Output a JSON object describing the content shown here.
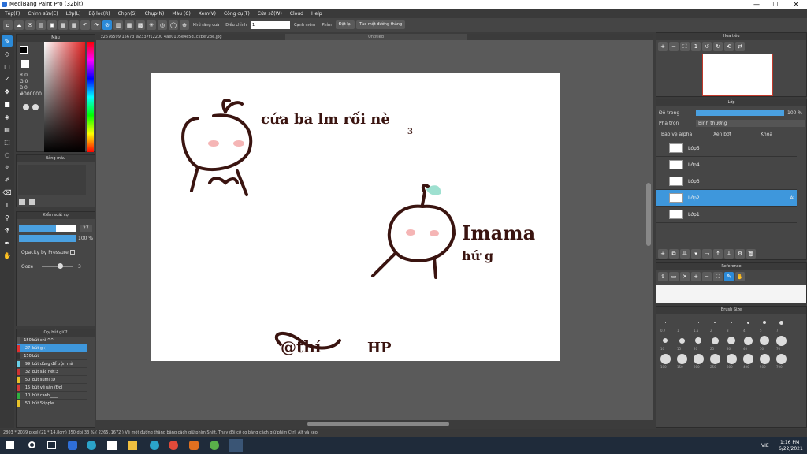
{
  "window": {
    "title": "MediBang Paint Pro (32bit)",
    "min": "—",
    "max": "☐",
    "close": "✕"
  },
  "menu": [
    "Tệp(F)",
    "Chỉnh sửa(E)",
    "Lớp(L)",
    "Bộ lọc(R)",
    "Chọn(S)",
    "Chụp(N)",
    "Màu (C)",
    "Xem(V)",
    "Công cụ(T)",
    "Cửa sổ(W)",
    "Cloud",
    "Help"
  ],
  "toolbar": {
    "anti_alias": "Khử răng cưa",
    "adjust_label": "Điều chỉnh",
    "adjust_value": "1",
    "snap_label": "Cạnh mềm",
    "snap2": "Phím",
    "off_label": "Đặt lại",
    "line_button": "Tạo một đường thẳng"
  },
  "color_panel": {
    "title": "Màu",
    "r": "R 0",
    "g": "G 0",
    "b": "B 0",
    "hex": "#000000"
  },
  "palette_panel": {
    "title": "Bảng màu"
  },
  "brush_control": {
    "title": "Kiểm soát cọ",
    "size_value": "27",
    "opacity_value": "100 %",
    "opacity_by_pressure": "Opacity by Pressure",
    "ooze_label": "Ooze",
    "ooze_value": "3",
    "size_fill": 0.65,
    "opacity_fill": 1.0
  },
  "brush_list": {
    "title": "Cọ/ bút giữ?",
    "items": [
      {
        "size": "150",
        "name": "bút chì ^^",
        "color": "#555555"
      },
      {
        "size": "27",
        "name": "bút g :)",
        "color": "#e03030"
      },
      {
        "size": "150",
        "name": "bút",
        "color": "#333333"
      },
      {
        "size": "99",
        "name": "bút dùng để trộn mà",
        "color": "#6ad0e8"
      },
      {
        "size": "32",
        "name": "bút sắc nét:3",
        "color": "#cc3333"
      },
      {
        "size": "50",
        "name": "bút sumi :D",
        "color": "#e8c22a"
      },
      {
        "size": "15",
        "name": "bút vẽ sán (Đc)",
        "color": "#d83a3a"
      },
      {
        "size": "10",
        "name": "bút canh____",
        "color": "#30b040"
      },
      {
        "size": "50",
        "name": "bút Stipple",
        "color": "#e8c22a"
      }
    ]
  },
  "document": {
    "tab1": "z2676599 15673_a2337f12200 4ae0105e4e5d1c2bef23e.jpg",
    "tab2": "Untitled",
    "canvas_text": [
      "cứa ba lm rối nè",
      "Imama",
      "hứ g",
      "@thí",
      "HP",
      "3"
    ]
  },
  "navigator": {
    "title": "Hoa tiêu"
  },
  "layers": {
    "title": "Lớp",
    "opacity_label": "Độ trong",
    "opacity_value": "100 %",
    "blend_label": "Pha trộn",
    "blend_value": "Bình thường",
    "protect_alpha": "Bảo vệ alpha",
    "clip": "Xén bớt",
    "lock": "Khóa",
    "items": [
      "Lớp5",
      "Lớp4",
      "Lớp3",
      "Lớp2",
      "Lớp1"
    ]
  },
  "reference": {
    "title": "Reference"
  },
  "brush_size": {
    "title": "Brush Size",
    "row1": [
      "0.7",
      "1",
      "1.5",
      "2",
      "3",
      "4",
      "5",
      "7"
    ],
    "row2": [
      "10",
      "15",
      "20",
      "25",
      "30",
      "40",
      "50",
      "70"
    ],
    "row3": [
      "100",
      "150",
      "200",
      "250",
      "300",
      "400",
      "500",
      "700"
    ]
  },
  "status": "2803 * 2039 pixel  (21 * 14.8cm)  350 dpi  33 %  ( 2265, 1672 )  Vẽ một đường thẳng bằng cách giữ phím Shift, Thay đổi cỡ cọ bằng cách giữ phím Ctrl, Alt và kéo",
  "taskbar": {
    "time": "1:16 PM",
    "date": "6/22/2021",
    "lang": "VIE"
  }
}
